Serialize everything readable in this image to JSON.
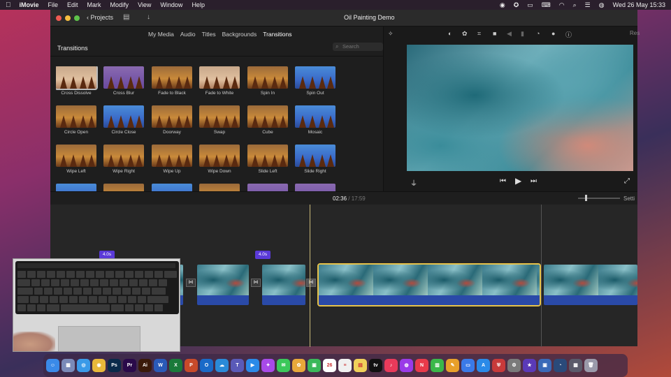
{
  "menubar": {
    "apple": "",
    "app": "iMovie",
    "items": [
      "File",
      "Edit",
      "Mark",
      "Modify",
      "View",
      "Window",
      "Help"
    ],
    "clock": "Wed 26 May  15:33"
  },
  "window": {
    "title": "Oil Painting Demo",
    "back_label": "Projects"
  },
  "browser": {
    "tabs": [
      "My Media",
      "Audio",
      "Titles",
      "Backgrounds",
      "Transitions"
    ],
    "selected_tab": "Transitions",
    "heading": "Transitions",
    "search_placeholder": "Search",
    "transitions": [
      {
        "label": "Cross Dissolve",
        "style": "light",
        "selected": true
      },
      {
        "label": "Cross Blur",
        "style": "purple"
      },
      {
        "label": "Fade to Black",
        "style": "normal"
      },
      {
        "label": "Fade to White",
        "style": "light"
      },
      {
        "label": "Spin In",
        "style": "normal"
      },
      {
        "label": "Spin Out",
        "style": "blue"
      },
      {
        "label": "Circle Open",
        "style": "normal"
      },
      {
        "label": "Circle Close",
        "style": "blue"
      },
      {
        "label": "Doorway",
        "style": "normal"
      },
      {
        "label": "Swap",
        "style": "normal"
      },
      {
        "label": "Cube",
        "style": "normal"
      },
      {
        "label": "Mosaic",
        "style": "blue"
      },
      {
        "label": "Wipe Left",
        "style": "normal"
      },
      {
        "label": "Wipe Right",
        "style": "normal"
      },
      {
        "label": "Wipe Up",
        "style": "normal"
      },
      {
        "label": "Wipe Down",
        "style": "normal"
      },
      {
        "label": "Slide Left",
        "style": "normal"
      },
      {
        "label": "Slide Right",
        "style": "blue"
      },
      {
        "label": "",
        "style": "blue"
      },
      {
        "label": "",
        "style": "normal"
      },
      {
        "label": "",
        "style": "blue"
      },
      {
        "label": "",
        "style": "normal"
      },
      {
        "label": "",
        "style": "purple"
      },
      {
        "label": "",
        "style": "purple"
      }
    ]
  },
  "viewer": {
    "reset_label": "Res",
    "tool_icons": [
      "magic-wand-icon",
      "color-balance-icon",
      "color-palette-icon",
      "crop-icon",
      "camera-icon",
      "volume-icon",
      "equalizer-icon",
      "speed-icon",
      "filter-icon",
      "info-icon"
    ]
  },
  "timeline": {
    "current_time": "02:36",
    "total_time": "17:59",
    "separator": "/",
    "settings_label": "Setti",
    "transition_durations": [
      "4.0s",
      "4.0s"
    ]
  },
  "dock": {
    "apps": [
      {
        "name": "finder",
        "color": "#3a8ae8",
        "glyph": "☺"
      },
      {
        "name": "launchpad",
        "color": "#7a8ab8",
        "glyph": "▦"
      },
      {
        "name": "safari",
        "color": "#3a9ae8",
        "glyph": "◎"
      },
      {
        "name": "chrome",
        "color": "#e8b83a",
        "glyph": "◉"
      },
      {
        "name": "photoshop",
        "color": "#0a2a4a",
        "glyph": "Ps"
      },
      {
        "name": "premiere",
        "color": "#2a0a4a",
        "glyph": "Pr"
      },
      {
        "name": "illustrator",
        "color": "#3a1a0a",
        "glyph": "Ai"
      },
      {
        "name": "word",
        "color": "#2a5ab8",
        "glyph": "W"
      },
      {
        "name": "excel",
        "color": "#1a7a3a",
        "glyph": "X"
      },
      {
        "name": "powerpoint",
        "color": "#c84a2a",
        "glyph": "P"
      },
      {
        "name": "outlook",
        "color": "#1a6ac8",
        "glyph": "O"
      },
      {
        "name": "onedrive",
        "color": "#2a8ad8",
        "glyph": "☁"
      },
      {
        "name": "teams",
        "color": "#5a5ab8",
        "glyph": "T"
      },
      {
        "name": "zoom",
        "color": "#2a8ae8",
        "glyph": "▶"
      },
      {
        "name": "messenger",
        "color": "#a84ae8",
        "glyph": "✦"
      },
      {
        "name": "messages",
        "color": "#3ac85a",
        "glyph": "✉"
      },
      {
        "name": "photos",
        "color": "#e8a83a",
        "glyph": "✿"
      },
      {
        "name": "facetime",
        "color": "#3ab85a",
        "glyph": "▣"
      },
      {
        "name": "calendar",
        "color": "#ffffff",
        "glyph": "26"
      },
      {
        "name": "reminders",
        "color": "#f0f0f0",
        "glyph": "≡"
      },
      {
        "name": "notes",
        "color": "#f0d05a",
        "glyph": "▤"
      },
      {
        "name": "apple-tv",
        "color": "#111111",
        "glyph": "tv"
      },
      {
        "name": "music",
        "color": "#e83a5a",
        "glyph": "♪"
      },
      {
        "name": "podcasts",
        "color": "#9a3ae8",
        "glyph": "◍"
      },
      {
        "name": "news",
        "color": "#e83a4a",
        "glyph": "N"
      },
      {
        "name": "numbers",
        "color": "#3ab84a",
        "glyph": "▥"
      },
      {
        "name": "pages",
        "color": "#e8a02a",
        "glyph": "✎"
      },
      {
        "name": "keynote",
        "color": "#3a7ae8",
        "glyph": "▭"
      },
      {
        "name": "app-store",
        "color": "#2a8ae8",
        "glyph": "A"
      },
      {
        "name": "toolbox",
        "color": "#c83a3a",
        "glyph": "⛨"
      },
      {
        "name": "system-preferences",
        "color": "#7a7a7a",
        "glyph": "⚙"
      },
      {
        "name": "imovie",
        "color": "#5a3ab8",
        "glyph": "★"
      },
      {
        "name": "preview",
        "color": "#3a6ab8",
        "glyph": "▣"
      },
      {
        "name": "quicktime",
        "color": "#2a4a7a",
        "glyph": "◔"
      },
      {
        "name": "screenshots",
        "color": "#5a5a6a",
        "glyph": "▦"
      },
      {
        "name": "trash",
        "color": "#9a9aaa",
        "glyph": "🗑"
      }
    ]
  }
}
